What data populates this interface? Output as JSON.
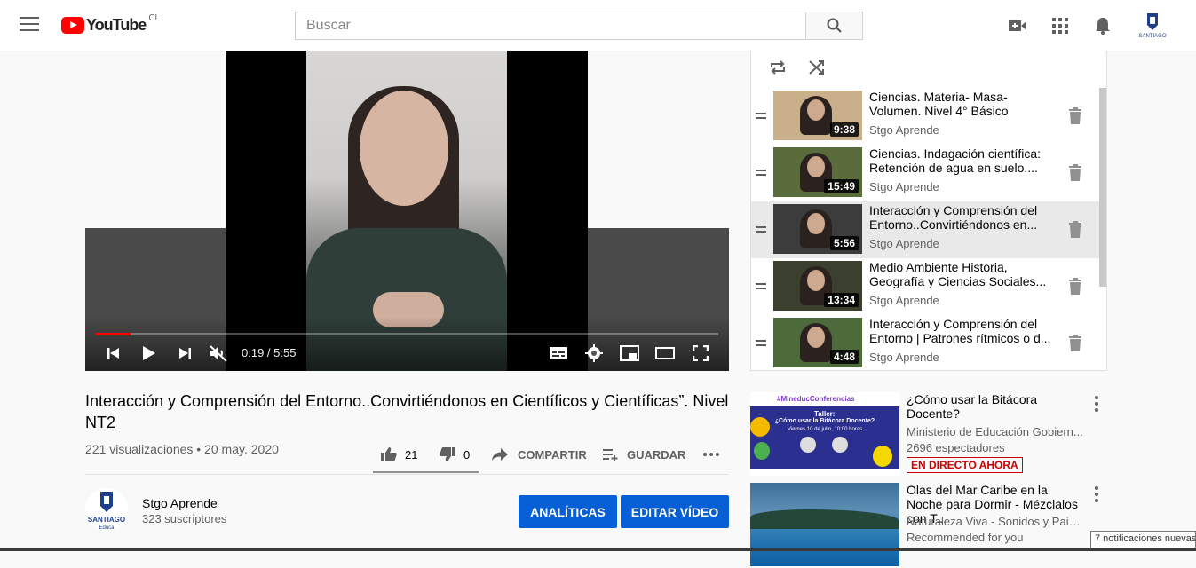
{
  "header": {
    "logo_text": "YouTube",
    "country_code": "CL",
    "search_placeholder": "Buscar",
    "avatar_text": "SANTIAGO"
  },
  "player": {
    "time_display": "0:19 / 5:55",
    "progress_fraction": 0.055
  },
  "video": {
    "title": "Interacción y Comprensión del Entorno..Convirtiéndonos en Científicos y Científicas”. Nivel NT2",
    "views": "221 visualizaciones",
    "separator": " • ",
    "date": "20 may. 2020",
    "likes": "21",
    "dislikes": "0",
    "share_label": "COMPARTIR",
    "save_label": "GUARDAR"
  },
  "channel": {
    "name": "Stgo Aprende",
    "subscribers": "323 suscriptores",
    "avatar_text": "SANTIAGO",
    "avatar_sub": "Educa",
    "analytics_label": "ANALÍTICAS",
    "edit_label": "EDITAR VÍDEO"
  },
  "playlist": {
    "items": [
      {
        "title": "Ciencias. Materia- Masa- Volumen. Nivel 4° Básico",
        "channel": "Stgo Aprende",
        "duration": "9:38",
        "active": false,
        "thumb_color": "#c9b08a"
      },
      {
        "title": "Ciencias. Indagación científica: Retención de agua en suelo....",
        "channel": "Stgo Aprende",
        "duration": "15:49",
        "active": false,
        "thumb_color": "#5a6b3c"
      },
      {
        "title": "Interacción y Comprensión del Entorno..Convirtiéndonos en...",
        "channel": "Stgo Aprende",
        "duration": "5:56",
        "active": true,
        "thumb_color": "#3c3c3c"
      },
      {
        "title": "Medio Ambiente Historia, Geografía y Ciencias Sociales...",
        "channel": "Stgo Aprende",
        "duration": "13:34",
        "active": false,
        "thumb_color": "#3b3f2e"
      },
      {
        "title": "Interacción y Comprensión del Entorno | Patrones rítmicos o d...",
        "channel": "Stgo Aprende",
        "duration": "4:48",
        "active": false,
        "thumb_color": "#4d6a3a"
      }
    ]
  },
  "recommendations": [
    {
      "title": "¿Cómo usar la Bitácora Docente?",
      "channel": "Ministerio de Educación Gobiern...",
      "sub": "2696 espectadores",
      "badge": "EN DIRECTO AHORA",
      "thumb_heading": "#MineducConferencias",
      "thumb_line1": "Taller:",
      "thumb_line2": "¿Cómo usar la Bitácora Docente?",
      "thumb_line3": "Viernes 10 de julio, 10:00 horas"
    },
    {
      "title": "Olas del Mar Caribe en la Noche para Dormir - Mézclalos con T...",
      "channel": "Naturaleza Viva - Sonidos y Paisa...",
      "sub": "Recommended for you"
    }
  ],
  "tooltip": "7 notificaciones nuevas",
  "colors": {
    "accent_blue": "#065fd4",
    "progress_red": "#ff0000",
    "live_red": "#cc0000"
  },
  "icons": [
    "menu-icon",
    "youtube-logo-icon",
    "search-icon",
    "create-video-icon",
    "apps-grid-icon",
    "notifications-bell-icon",
    "previous-icon",
    "play-icon",
    "next-icon",
    "mute-icon",
    "subtitles-icon",
    "settings-gear-icon",
    "miniplayer-icon",
    "theater-mode-icon",
    "fullscreen-icon",
    "like-icon",
    "dislike-icon",
    "share-icon",
    "add-to-playlist-icon",
    "more-icon",
    "loop-icon",
    "shuffle-icon",
    "drag-handle-icon",
    "trash-icon"
  ]
}
